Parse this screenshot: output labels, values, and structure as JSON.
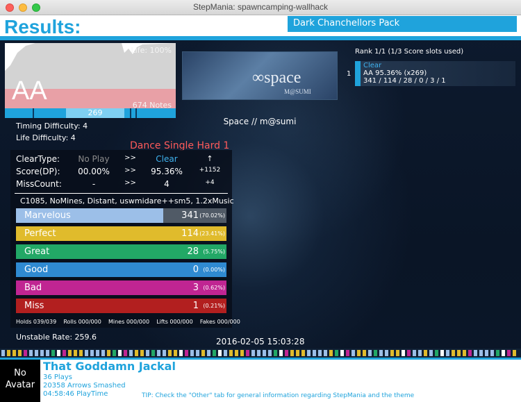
{
  "window": {
    "title": "StepMania: spawncamping-wallhack"
  },
  "header": {
    "title": "Results:",
    "pack_name": "Dark Chanchellors Pack"
  },
  "life_graph": {
    "grade": "AA",
    "life_label": "Life: 100%",
    "notes_label": "674 Notes",
    "combo_label": "269"
  },
  "banner": {
    "logo_text": "∞space",
    "logo_sub": "M@SUMI"
  },
  "song": {
    "title": "Space // m@sumi"
  },
  "difficulty_info": {
    "timing": "Timing Difficulty: 4",
    "life": "Life Difficulty: 4",
    "chart": "Dance Single Hard 1"
  },
  "rank": {
    "header": "Rank 1/1 (1/3 Score slots used)",
    "slot_number": "1",
    "clear": "Clear",
    "score": "AA 95.36% (x269)",
    "judgments": "341 / 114 / 28 / 0 / 3 / 1"
  },
  "stats": {
    "rows": [
      {
        "label": "ClearType:",
        "prev": "No Play",
        "arrow": ">>",
        "curr": "Clear",
        "diff": "↑"
      },
      {
        "label": "Score(DP):",
        "prev": "00.00%",
        "arrow": ">>",
        "curr": "95.36%",
        "diff": "+1152"
      },
      {
        "label": "MissCount:",
        "prev": "-",
        "arrow": ">>",
        "curr": "4",
        "diff": "+4"
      }
    ],
    "modifiers": "C1085, NoMines, Distant, uswmidare++sm5, 1.2xMusic"
  },
  "judgments": [
    {
      "name": "Marvelous",
      "count": "341",
      "percent": "(70.02%)",
      "fraction": 0.7,
      "color": "#9cbfe8"
    },
    {
      "name": "Perfect",
      "count": "114",
      "percent": "(23.41%)",
      "fraction": 0.234,
      "color": "#e0bb2c"
    },
    {
      "name": "Great",
      "count": "28",
      "percent": "(5.75%)",
      "fraction": 0.0575,
      "color": "#22a866"
    },
    {
      "name": "Good",
      "count": "0",
      "percent": "(0.00%)",
      "fraction": 0.0,
      "color": "#2f8ad1"
    },
    {
      "name": "Bad",
      "count": "3",
      "percent": "(0.62%)",
      "fraction": 0.0062,
      "color": "#c02592"
    },
    {
      "name": "Miss",
      "count": "1",
      "percent": "(0.21%)",
      "fraction": 0.0021,
      "color": "#b21f1f"
    }
  ],
  "radar": {
    "holds": "Holds 039/039",
    "rolls": "Rolls 000/000",
    "mines": "Mines 000/000",
    "lifts": "Lifts 000/000",
    "fakes": "Fakes 000/000"
  },
  "unstable_rate": "Unstable Rate: 259.6",
  "datetime": "2016-02-05 15:03:28",
  "player": {
    "avatar_line1": "No",
    "avatar_line2": "Avatar",
    "name": "That Goddamn Jackal",
    "plays": "36 Plays",
    "arrows": "20358 Arrows Smashed",
    "playtime": "04:58:46 PlayTime"
  },
  "tip": "TIP: Check the \"Other\" tab for general information regarding StepMania and the theme",
  "colors": {
    "accent": "#1fa3dc",
    "difficulty": "#ff5a5a"
  }
}
